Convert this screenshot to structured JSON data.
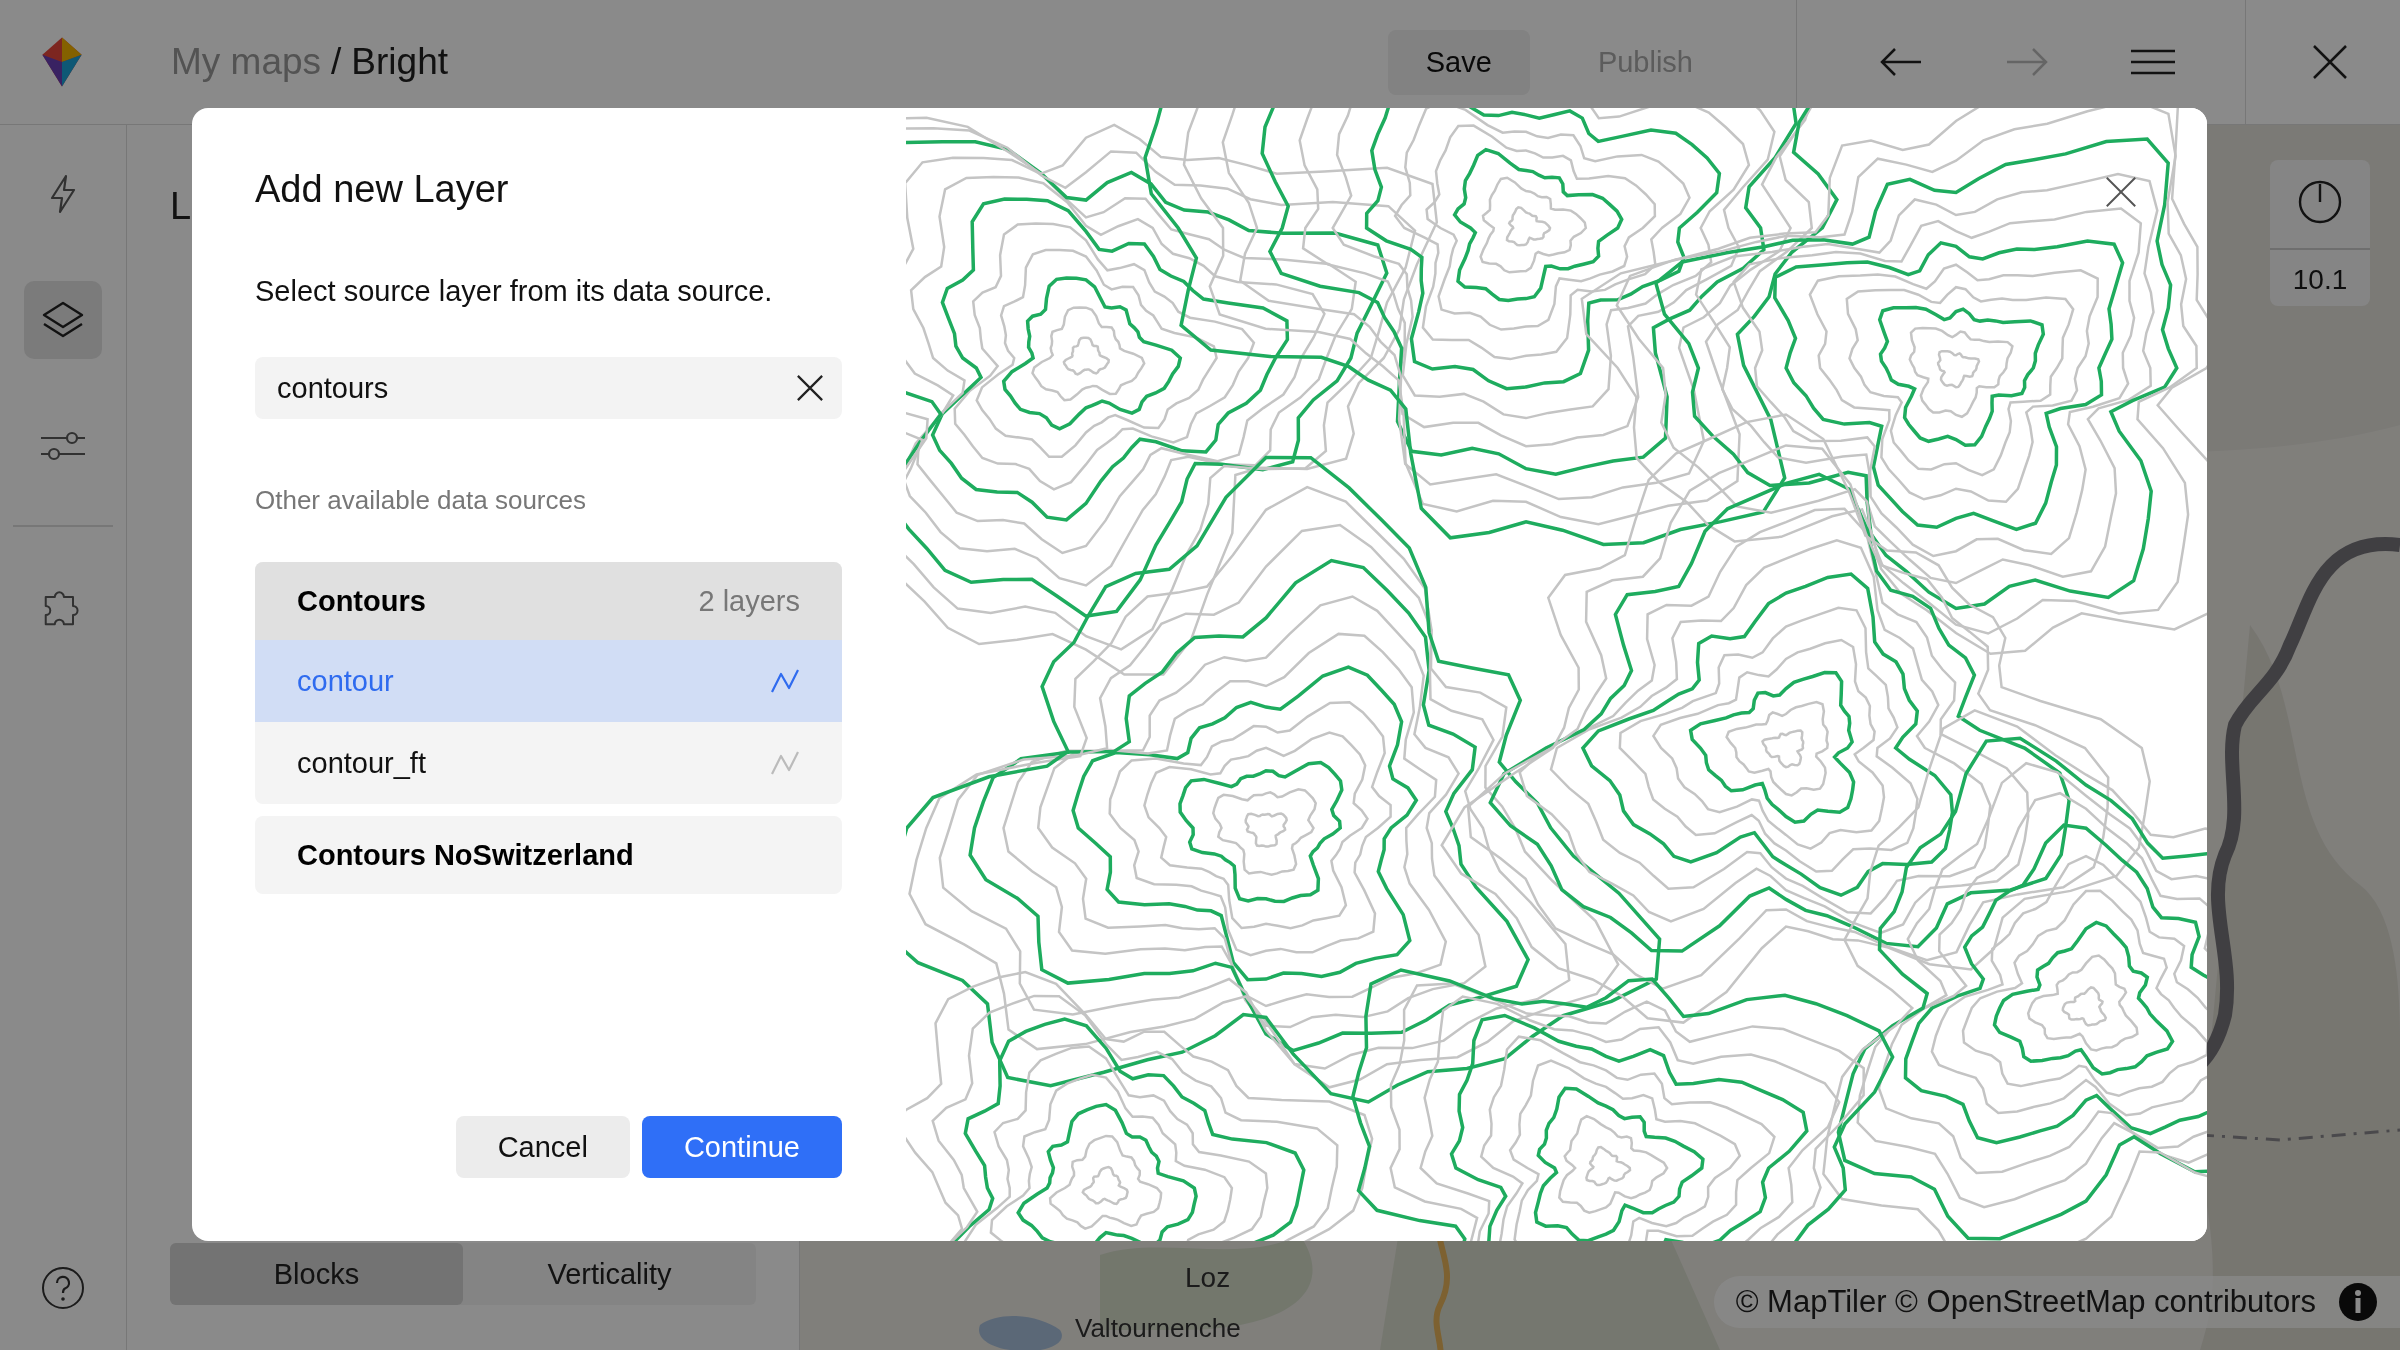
{
  "header": {
    "breadcrumb": {
      "parent": "My maps",
      "separator": "/",
      "current": "Bright"
    },
    "actions": [
      {
        "label": "Save",
        "disabled": false
      },
      {
        "label": "Publish",
        "disabled": true
      }
    ],
    "nav": [
      {
        "disabled": false
      },
      {
        "disabled": true
      }
    ]
  },
  "sidebar": {
    "items": [
      {
        "selected": false
      },
      {
        "selected": true
      },
      {
        "selected": false
      },
      {
        "selected": false
      }
    ]
  },
  "left_panel": {
    "heading": "L",
    "tabs": [
      {
        "label": "Blocks",
        "selected": true
      },
      {
        "label": "Verticality",
        "selected": false
      }
    ]
  },
  "map": {
    "labels": [
      "Loz",
      "Valtournenche"
    ],
    "zoom": "10.1",
    "attribution": "© MapTiler © OpenStreetMap contributors"
  },
  "dialog": {
    "title": "Add new Layer",
    "description": "Select source layer from its data source.",
    "search": {
      "value": "contours"
    },
    "section_label": "Other available data sources",
    "sources": [
      {
        "name": "Contours",
        "count": "2 layers",
        "expanded": true,
        "layers": [
          {
            "name": "contour",
            "selected": true
          },
          {
            "name": "contour_ft",
            "selected": false
          }
        ]
      },
      {
        "name": "Contours NoSwitzerland",
        "expanded": false
      }
    ],
    "buttons": [
      {
        "label": "Cancel",
        "kind": "secondary"
      },
      {
        "label": "Continue",
        "kind": "primary"
      }
    ]
  }
}
